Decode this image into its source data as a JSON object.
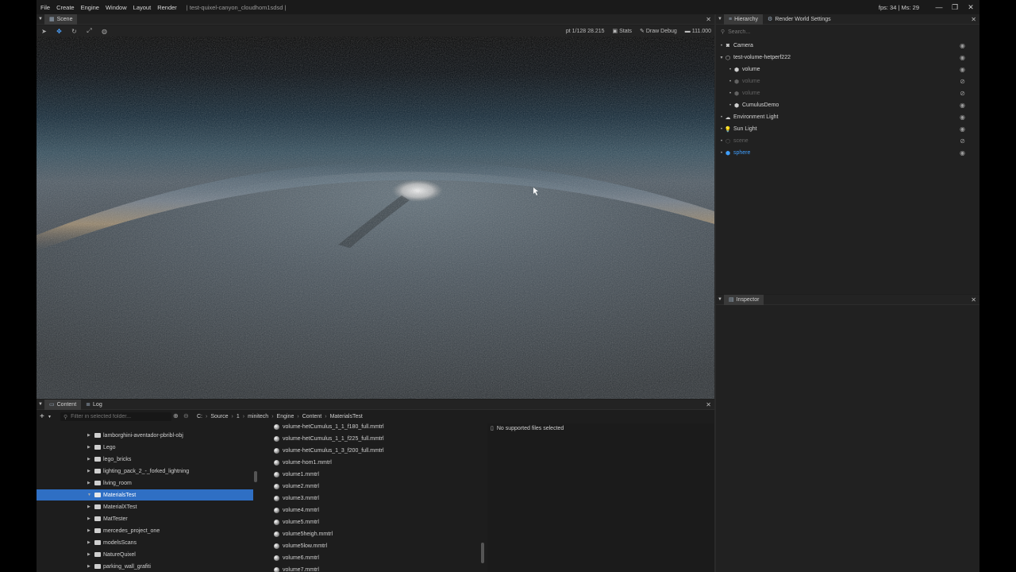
{
  "menu": [
    "File",
    "Create",
    "Engine",
    "Window",
    "Layout",
    "Render"
  ],
  "doc_title": "| test-quixel-canyon_cloudhom1sdsd |",
  "perf": "fps: 34 | Ms: 29",
  "window_buttons": {
    "minimize": "—",
    "restore": "❐",
    "close": "✕"
  },
  "scene": {
    "tab": "Scene",
    "close": "✕",
    "info": "pt 1/128 28.215",
    "stats": "Stats",
    "draw_debug": "Draw Debug",
    "camera_value": "111.000"
  },
  "hierarchy": {
    "tabs": [
      "Hierarchy",
      "Render World Settings"
    ],
    "search_placeholder": "Search...",
    "items": [
      {
        "label": "Camera",
        "icon": "camera-icon"
      },
      {
        "label": "test-volume-hetperf222",
        "icon": "group-icon"
      },
      {
        "label": "volume",
        "icon": "cube-icon"
      },
      {
        "label": "volume",
        "icon": "cube-icon",
        "state": "hidden"
      },
      {
        "label": "volume",
        "icon": "cube-icon",
        "state": "hidden"
      },
      {
        "label": "CumulusDemo",
        "icon": "cube-icon"
      },
      {
        "label": "Environment Light",
        "icon": "environment-light-icon"
      },
      {
        "label": "Sun Light",
        "icon": "light-icon"
      },
      {
        "label": "scene",
        "icon": "group-icon",
        "state": "hidden"
      },
      {
        "label": "sphere",
        "icon": "cube-icon",
        "state": "selected"
      }
    ]
  },
  "inspector": {
    "tab": "Inspector"
  },
  "content": {
    "tabs": [
      "Content",
      "Log"
    ],
    "folder_search_placeholder": "Filter in selected folder...",
    "breadcrumb": [
      "C:",
      "Source",
      "1",
      "minitech",
      "Engine",
      "Content",
      "MaterialsTest"
    ],
    "folders": [
      "lamborghini-aventador-pbribl-obj",
      "Lego",
      "lego_bricks",
      "lighting_pack_2_-_forked_lightning",
      "living_room",
      "MaterialsTest",
      "MaterialXTest",
      "MatTester",
      "mercedes_project_one",
      "modelsScans",
      "NatureQuixel",
      "parking_wall_grafiti"
    ],
    "selected_folder": "MaterialsTest",
    "files": [
      "volume-hetCumulus_1_1_f180_full.mmtrl",
      "volume-hetCumulus_1_1_f225_full.mmtrl",
      "volume-hetCumulus_1_3_f200_full.mmtrl",
      "volume-hom1.mmtrl",
      "volume1.mmtrl",
      "volume2.mmtrl",
      "volume3.mmtrl",
      "volume4.mmtrl",
      "volume5.mmtrl",
      "volume5heigh.mmtrl",
      "volume5low.mmtrl",
      "volume6.mmtrl",
      "volume7.mmtrl"
    ],
    "preview_message": "No supported files selected"
  },
  "colors": {
    "accent": "#3f9fff",
    "selection": "#2f6fc4",
    "panel": "#1e1e1e"
  }
}
